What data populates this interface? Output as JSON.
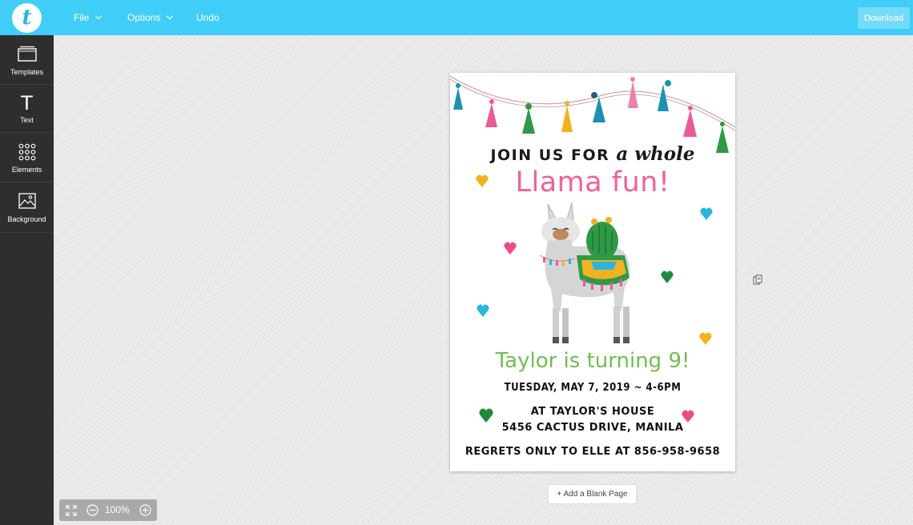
{
  "topbar": {
    "logo_letter": "t",
    "menu": [
      {
        "label": "File",
        "has_dropdown": true
      },
      {
        "label": "Options",
        "has_dropdown": true
      },
      {
        "label": "Undo",
        "has_dropdown": false
      }
    ],
    "download_label": "Download"
  },
  "sidebar": {
    "items": [
      {
        "label": "Templates",
        "icon": "templates-icon"
      },
      {
        "label": "Text",
        "icon": "text-icon"
      },
      {
        "label": "Elements",
        "icon": "elements-icon"
      },
      {
        "label": "Background",
        "icon": "background-icon"
      }
    ]
  },
  "invitation": {
    "line1": "JOIN US FOR",
    "line1_script": "a whole",
    "headline": "Llama fun!",
    "name_line": "Taylor is turning 9!",
    "date_line": "TUESDAY, MAY 7, 2019 ~ 4-6PM",
    "venue_line1": "AT TAYLOR'S HOUSE",
    "venue_line2": "5456 CACTUS DRIVE, MANILA",
    "rsvp_line": "REGRETS ONLY TO ELLE AT 856-958-9658",
    "colors": {
      "headline": "#f0619a",
      "name_line": "#6fbf52"
    }
  },
  "canvas": {
    "add_page_label": "+ Add a Blank Page",
    "zoom_level": "100%"
  },
  "colors": {
    "topbar": "#40cdf7",
    "sidebar": "#2e2e2e"
  }
}
